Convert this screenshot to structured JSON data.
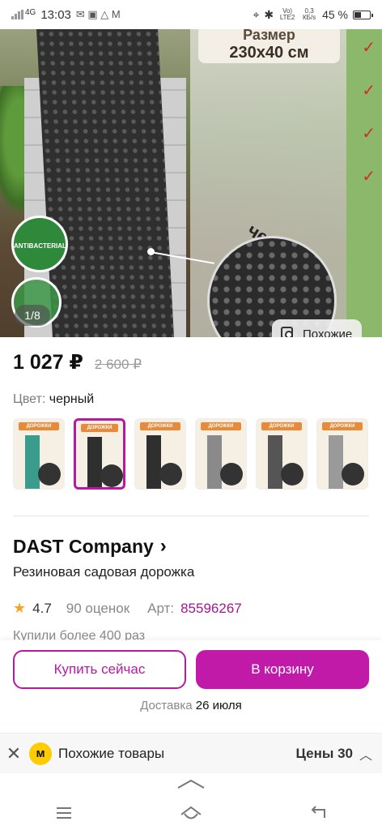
{
  "status": {
    "network": "4G",
    "time": "13:03",
    "volte": "Vo) LTE2",
    "speed": "0,3 КБ/s",
    "battery": "45 %"
  },
  "hero": {
    "size_label_l1": "Размер",
    "size_label_l2": "230x40 см",
    "color_label": "черный",
    "badge": "ANTIBACTERIAL",
    "counter": "1/8",
    "similar_chip": "Похожие"
  },
  "product": {
    "price": "1 027 ₽",
    "old_price": "2 600 ₽",
    "color_label": "Цвет:",
    "color_value": "черный",
    "thumb_header": "ДОРОЖКИ",
    "thumbs": [
      {
        "strip": "#3a9c8c",
        "selected": false
      },
      {
        "strip": "#2f2f2f",
        "selected": true
      },
      {
        "strip": "#2f2f2f",
        "selected": false
      },
      {
        "strip": "#8a8a8a",
        "selected": false
      },
      {
        "strip": "#555555",
        "selected": false
      },
      {
        "strip": "#9a9a9a",
        "selected": false
      }
    ],
    "seller": "DAST Company",
    "name": "Резиновая садовая дорожка",
    "rating": "4.7",
    "reviews": "90 оценок",
    "art_label": "Арт:",
    "art_value": "85596267",
    "bought": "Купили более 400 раз"
  },
  "actions": {
    "buy_now": "Купить сейчас",
    "to_cart": "В корзину",
    "delivery_label": "Доставка",
    "delivery_date": "26 июля"
  },
  "similar": {
    "title": "Похожие товары",
    "prices_label": "Цены 30"
  },
  "colors": {
    "accent": "#c21aa8",
    "accent_dark": "#a01894",
    "star": "#f5a623"
  }
}
